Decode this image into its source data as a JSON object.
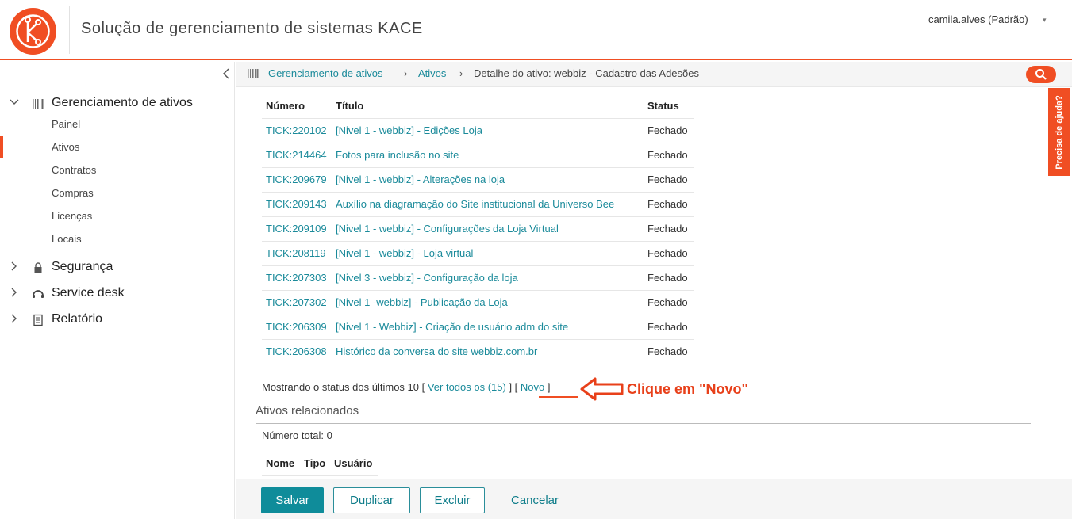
{
  "header": {
    "app_title": "Solução de gerenciamento de sistemas KACE",
    "user": "camila.alves (Padrão)",
    "user_caret": "▾"
  },
  "sidebar": {
    "groups": [
      {
        "label": "Gerenciamento de ativos",
        "icon": "barcode-icon",
        "expanded": true,
        "items": [
          "Painel",
          "Ativos",
          "Contratos",
          "Compras",
          "Licenças",
          "Locais"
        ]
      },
      {
        "label": "Segurança",
        "icon": "lock-icon",
        "expanded": false
      },
      {
        "label": "Service desk",
        "icon": "headset-icon",
        "expanded": false
      },
      {
        "label": "Relatório",
        "icon": "report-icon",
        "expanded": false
      }
    ],
    "active_item": "Ativos"
  },
  "breadcrumb": {
    "items": [
      "Gerenciamento de ativos",
      "Ativos",
      "Detalhe do ativo: webbiz - Cadastro das Adesões"
    ],
    "separator": "›"
  },
  "help_tab": "Precisa de ajuda?",
  "tickets": {
    "columns": [
      "Número",
      "Título",
      "Status"
    ],
    "rows": [
      {
        "num": "TICK:220102",
        "title": "[Nivel 1 - webbiz] - Edições Loja",
        "status": "Fechado"
      },
      {
        "num": "TICK:214464",
        "title": "Fotos para inclusão no site",
        "status": "Fechado"
      },
      {
        "num": "TICK:209679",
        "title": "[Nivel 1 - webbiz] - Alterações na loja",
        "status": "Fechado"
      },
      {
        "num": "TICK:209143",
        "title": "Auxílio na diagramação do Site institucional da Universo Bee",
        "status": "Fechado"
      },
      {
        "num": "TICK:209109",
        "title": "[Nivel 1 - webbiz] - Configurações da Loja Virtual",
        "status": "Fechado"
      },
      {
        "num": "TICK:208119",
        "title": "[Nivel 1 - webbiz] - Loja virtual",
        "status": "Fechado"
      },
      {
        "num": "TICK:207303",
        "title": "[Nivel 3 - webbiz] - Configuração da loja",
        "status": "Fechado"
      },
      {
        "num": "TICK:207302",
        "title": "[Nivel 1 -webbiz] - Publicação da Loja",
        "status": "Fechado"
      },
      {
        "num": "TICK:206309",
        "title": "[Nivel 1 - Webbiz] - Criação de usuário adm do site",
        "status": "Fechado"
      },
      {
        "num": "TICK:206308",
        "title": "Histórico da conversa do site webbiz.com.br",
        "status": "Fechado"
      }
    ],
    "showing_prefix": "Mostrando o status dos últimos 10 [ ",
    "view_all": "Ver todos os (15)",
    "mid": " ] [ ",
    "new_link": "Novo",
    "suffix": " ]"
  },
  "annotation": "Clique em \"Novo\"",
  "related": {
    "title": "Ativos relacionados",
    "total": "Número total: 0",
    "columns": [
      "Nome",
      "Tipo",
      "Usuário"
    ]
  },
  "footer": {
    "save": "Salvar",
    "duplicate": "Duplicar",
    "delete": "Excluir",
    "cancel": "Cancelar"
  },
  "colors": {
    "accent": "#f04e23",
    "link": "#1a8a9a",
    "primary_button": "#0f8c9a"
  }
}
